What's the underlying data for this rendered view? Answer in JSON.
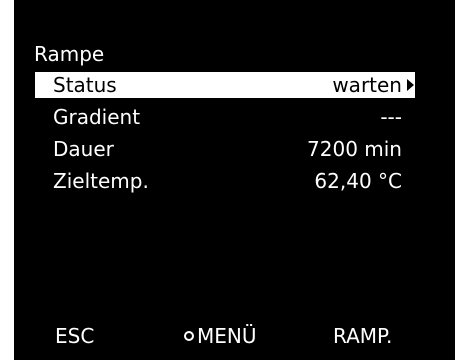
{
  "screen": {
    "title": "Rampe"
  },
  "rows": [
    {
      "label": "Status",
      "value": "warten",
      "selected": true
    },
    {
      "label": "Gradient",
      "value": "---"
    },
    {
      "label": "Dauer",
      "value": "7200 min"
    },
    {
      "label": "Zieltemp.",
      "value": "62,40 °C"
    }
  ],
  "softkeys": {
    "left": "ESC",
    "middle": "MENÜ",
    "right": "RAMP."
  },
  "colors": {
    "background": "#000000",
    "text": "#ffffff",
    "highlight": "#ffffff",
    "highlight_text": "#000000"
  },
  "icons": {
    "selected_row_indicator": "triangle-right-icon",
    "menu_key_indicator": "circle-icon"
  }
}
